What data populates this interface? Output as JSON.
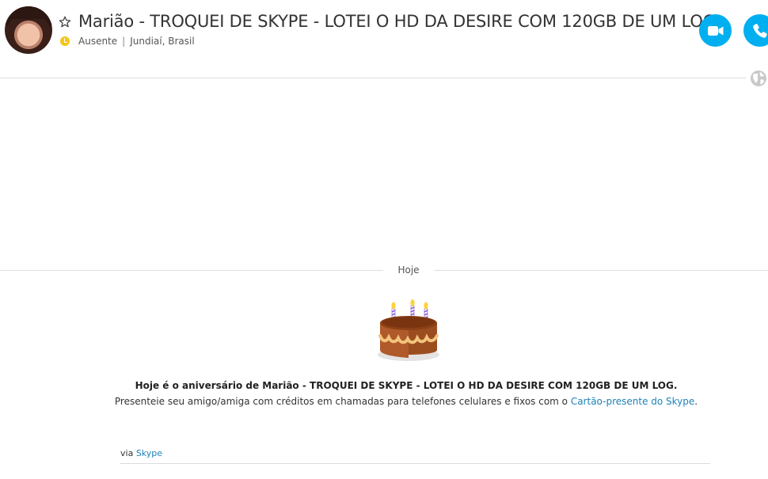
{
  "header": {
    "contact_name": "Marião - TROQUEI DE SKYPE - LOTEI O HD DA DESIRE COM 120GB DE UM LOG",
    "status": "Ausente",
    "location": "Jundiaí, Brasil",
    "separator": "|",
    "icons": {
      "favorite": "star-icon",
      "status": "away-clock-icon",
      "video_call": "video-camera-icon",
      "voice_call": "phone-icon",
      "language": "globe-icon"
    }
  },
  "colors": {
    "accent": "#00aff0",
    "status_away": "#f5c518",
    "link": "#1d82b7"
  },
  "conversation": {
    "day_label": "Hoje",
    "birthday_title": "Hoje é o aniversário de Marião - TROQUEI DE SKYPE - LOTEI O HD DA DESIRE COM 120GB DE UM LOG.",
    "birthday_desc_prefix": "Presenteie seu amigo/amiga com créditos em chamadas para telefones celulares e fixos com o ",
    "birthday_link": "Cartão-presente do Skype",
    "birthday_desc_suffix": ".",
    "via_prefix": "via ",
    "via_link": "Skype"
  }
}
